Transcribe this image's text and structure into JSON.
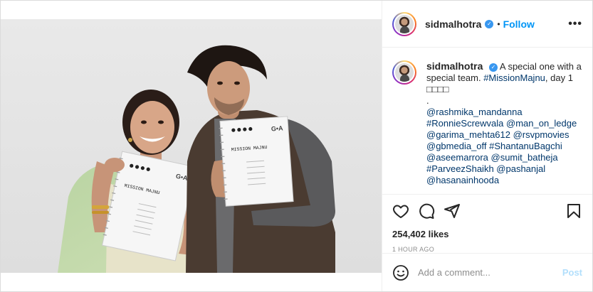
{
  "post": {
    "username": "sidmalhotra",
    "follow_label": "Follow",
    "separator": "•",
    "more_label": "•••",
    "caption": {
      "username": "sidmalhotra",
      "text_line1": "A special one with a",
      "text_line2a": "special team. ",
      "hashtag_main": "#MissionMajnu",
      "text_line2b": ", day 1",
      "emoji_line": "□□□□",
      "dot_line": ".",
      "tags": [
        "@rashmika_mandanna",
        "#RonnieScrewvala @man_on_ledge",
        "@garima_mehta612 @rsvpmovies",
        "@gbmedia_off #ShantanuBagchi",
        "@aseemarrora @sumit_batheja",
        "#ParveezShaikh @pashanjal",
        "@hasanainhooda"
      ]
    },
    "likes": "254,402 likes",
    "time": "1 HOUR AGO",
    "comment_placeholder": "Add a comment...",
    "post_label": "Post",
    "script_title": "MISSION MAJNU",
    "script_brand": "G•A",
    "icons": {
      "heart": "heart-icon",
      "comment": "comment-icon",
      "share": "share-icon",
      "save": "bookmark-icon",
      "emoji": "emoji-icon",
      "verified": "verified-badge-icon"
    },
    "colors": {
      "link": "#00376b",
      "follow": "#0095f6",
      "verified": "#3897f0",
      "post_disabled": "#b2dffc"
    }
  }
}
